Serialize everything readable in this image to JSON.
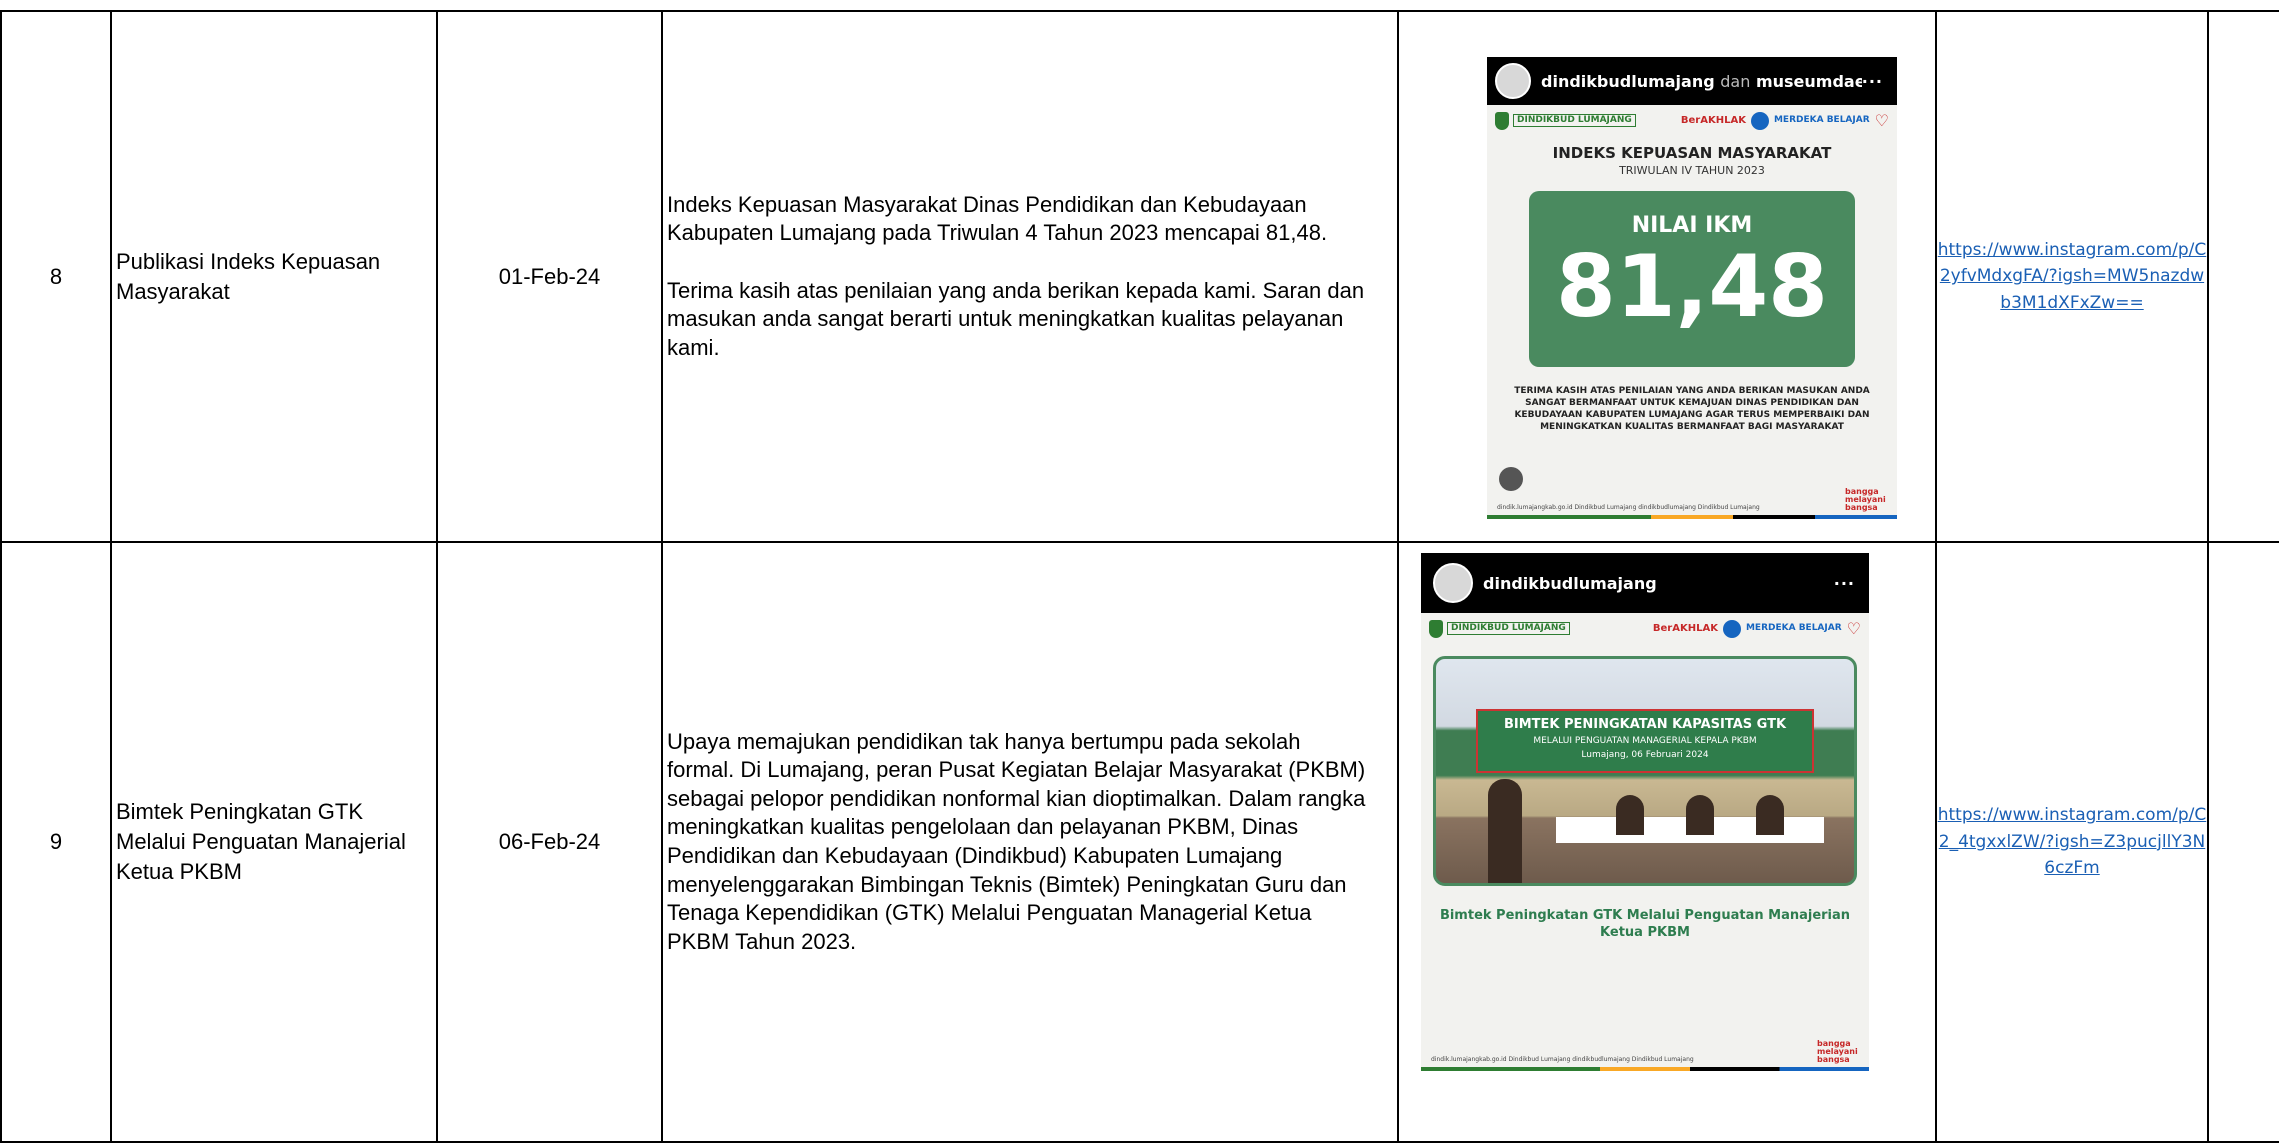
{
  "rows": [
    {
      "no": "8",
      "title": "Publikasi Indeks Kepuasan Masyarakat",
      "date": "01-Feb-24",
      "description": [
        "Indeks Kepuasan Masyarakat Dinas Pendidikan dan Kebudayaan Kabupaten Lumajang pada Triwulan 4 Tahun 2023 mencapai 81,48.",
        "Terima kasih atas penilaian yang anda berikan kepada kami. Saran dan masukan anda sangat berarti untuk meningkatkan kualitas pelayanan kami."
      ],
      "post": {
        "account": "dindikbudlumajang",
        "connector": "dan",
        "collab": "museumdaerah...",
        "more": "···",
        "dindikbud_logo": "DINDIKBUD LUMAJANG",
        "berakhlak": "BerAKHLAK",
        "merdeka": "MERDEKA BELAJAR",
        "heading": "INDEKS KEPUASAN MASYARAKAT",
        "subheading": "TRIWULAN IV TAHUN 2023",
        "box_label": "NILAI IKM",
        "box_value": "81,48",
        "thanks": "TERIMA KASIH ATAS PENILAIAN YANG ANDA BERIKAN MASUKAN ANDA SANGAT BERMANFAAT UNTUK KEMAJUAN DINAS PENDIDIKAN DAN KEBUDAYAAN KABUPATEN LUMAJANG AGAR TERUS MEMPERBAIKI DAN MENINGKATKAN KUALITAS BERMANFAAT BAGI MASYARAKAT",
        "footer": "dindik.lumajangkab.go.id   Dindikbud Lumajang   dindikbudlumajang   Dindikbud Lumajang",
        "bangga": "bangga melayani bangsa"
      },
      "link": "https://www.instagram.com/p/C2yfvMdxgFA/?igsh=MW5nazdwb3M1dXFxZw=="
    },
    {
      "no": "9",
      "title": "Bimtek Peningkatan GTK Melalui Penguatan Manajerial Ketua PKBM",
      "date": "06-Feb-24",
      "description": [
        "Upaya memajukan pendidikan tak hanya bertumpu pada sekolah formal. Di Lumajang, peran Pusat Kegiatan Belajar Masyarakat (PKBM) sebagai pelopor pendidikan nonformal kian dioptimalkan. Dalam rangka meningkatkan kualitas pengelolaan dan pelayanan PKBM, Dinas Pendidikan dan Kebudayaan (Dindikbud) Kabupaten Lumajang menyelenggarakan Bimbingan Teknis (Bimtek) Peningkatan Guru dan Tenaga Kependidikan (GTK) Melalui Penguatan Managerial Ketua PKBM Tahun 2023."
      ],
      "post": {
        "account": "dindikbudlumajang",
        "more": "···",
        "dindikbud_logo": "DINDIKBUD LUMAJANG",
        "berakhlak": "BerAKHLAK",
        "merdeka": "MERDEKA BELAJAR",
        "banner": "BIMTEK PENINGKATAN KAPASITAS GTK",
        "banner_sub": "MELALUI PENGUATAN MANAGERIAL KEPALA PKBM",
        "banner_date": "Lumajang, 06 Februari 2024",
        "caption": "Bimtek Peningkatan GTK Melalui Penguatan Manajerian Ketua PKBM",
        "footer": "dindik.lumajangkab.go.id   Dindikbud Lumajang   dindikbudlumajang   Dindikbud Lumajang",
        "bangga": "bangga melayani bangsa"
      },
      "link": "https://www.instagram.com/p/C2_4tgxxlZW/?igsh=Z3pucjllY3N6czFm"
    }
  ],
  "colors": {
    "link": "#1a5fb4",
    "ikm_green": "#4a8a5f",
    "border": "#000000"
  }
}
